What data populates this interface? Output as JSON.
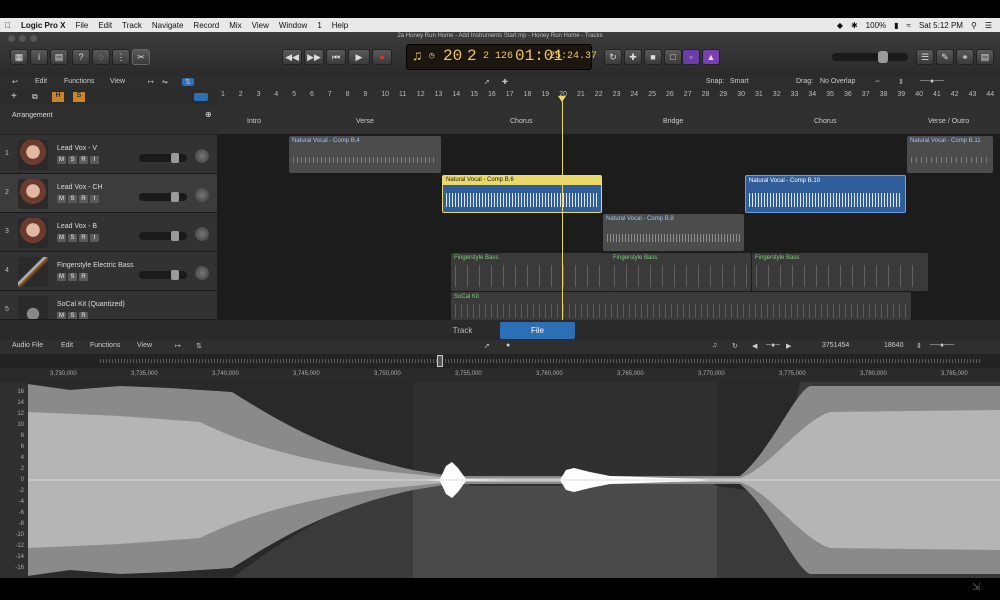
{
  "menubar": {
    "app": "Logic Pro X",
    "items": [
      "File",
      "Edit",
      "Track",
      "Navigate",
      "Record",
      "Mix",
      "View",
      "Window",
      "1",
      "Help"
    ],
    "battery": "100%",
    "clock": "Sat 5:12 PM"
  },
  "window": {
    "title": "2a Honey Run Home - Add Instruments Start mp - Honey Run Home - Tracks"
  },
  "lcd": {
    "bar": "20",
    "beat": "2",
    "div": "2",
    "tick": "126",
    "time": "01:01",
    "frames": "25:24.37"
  },
  "toolbar2": {
    "edit": "Edit",
    "functions": "Functions",
    "view": "View",
    "snap_label": "Snap:",
    "snap_value": "Smart",
    "drag_label": "Drag:",
    "drag_value": "No Overlap"
  },
  "arrangement": {
    "label": "Arrangement",
    "ruler_marks": [
      "1",
      "2",
      "3",
      "4",
      "5",
      "6",
      "7",
      "8",
      "9",
      "10",
      "11",
      "12",
      "13",
      "14",
      "15",
      "16",
      "17",
      "18",
      "19",
      "20",
      "21",
      "22",
      "23",
      "24",
      "25",
      "26",
      "27",
      "28",
      "29",
      "30",
      "31",
      "32",
      "33",
      "34",
      "35",
      "36",
      "37",
      "38",
      "39",
      "40",
      "41",
      "42",
      "43",
      "44"
    ],
    "sections": [
      "Intro",
      "Verse",
      "Chorus",
      "Bridge",
      "Chorus",
      "Verse / Outro"
    ]
  },
  "tracks": [
    {
      "num": "1",
      "name": "Lead Vox - V"
    },
    {
      "num": "2",
      "name": "Lead Vox - CH"
    },
    {
      "num": "3",
      "name": "Lead Vox - B"
    },
    {
      "num": "4",
      "name": "Fingerstyle Electric Bass"
    },
    {
      "num": "5",
      "name": "SoCal Kit (Quantized)"
    }
  ],
  "msr": [
    "M",
    "S",
    "R",
    "I"
  ],
  "regions": [
    {
      "label": "Natural Vocal - Comp B.4"
    },
    {
      "label": "Natural Vocal - Comp B.11"
    },
    {
      "label": "Natural Vocal - Comp B.6"
    },
    {
      "label": "Natural Vocal - Comp B.10"
    },
    {
      "label": "Natural Vocal - Comp B.8"
    },
    {
      "label": "Fingerstyle Bass"
    },
    {
      "label": "Fingerstyle Bass"
    },
    {
      "label": "Fingerstyle Bass"
    },
    {
      "label": "SoCal Kit"
    }
  ],
  "editor": {
    "tabs": [
      "Track",
      "File"
    ],
    "tools": {
      "audio_file": "Audio File",
      "edit": "Edit",
      "functions": "Functions",
      "view": "View",
      "position": "3751454",
      "length": "18640"
    },
    "sample_marks": [
      "3,730,000",
      "3,735,000",
      "3,740,000",
      "3,745,000",
      "3,750,000",
      "3,755,000",
      "3,760,000",
      "3,765,000",
      "3,770,000",
      "3,775,000",
      "3,780,000",
      "3,785,000"
    ],
    "db_marks": [
      "16",
      "14",
      "12",
      "10",
      "8",
      "6",
      "4",
      "2",
      "0",
      "-2",
      "-4",
      "-6",
      "-8",
      "-10",
      "-12",
      "-14",
      "-16"
    ]
  },
  "colors": {
    "accent": "#2d6fb5",
    "lcd": "#f2c463",
    "vocal_region": "#4c4c4c",
    "selected_region": "#2f5e9b",
    "header_yellow": "#e9d86a"
  }
}
